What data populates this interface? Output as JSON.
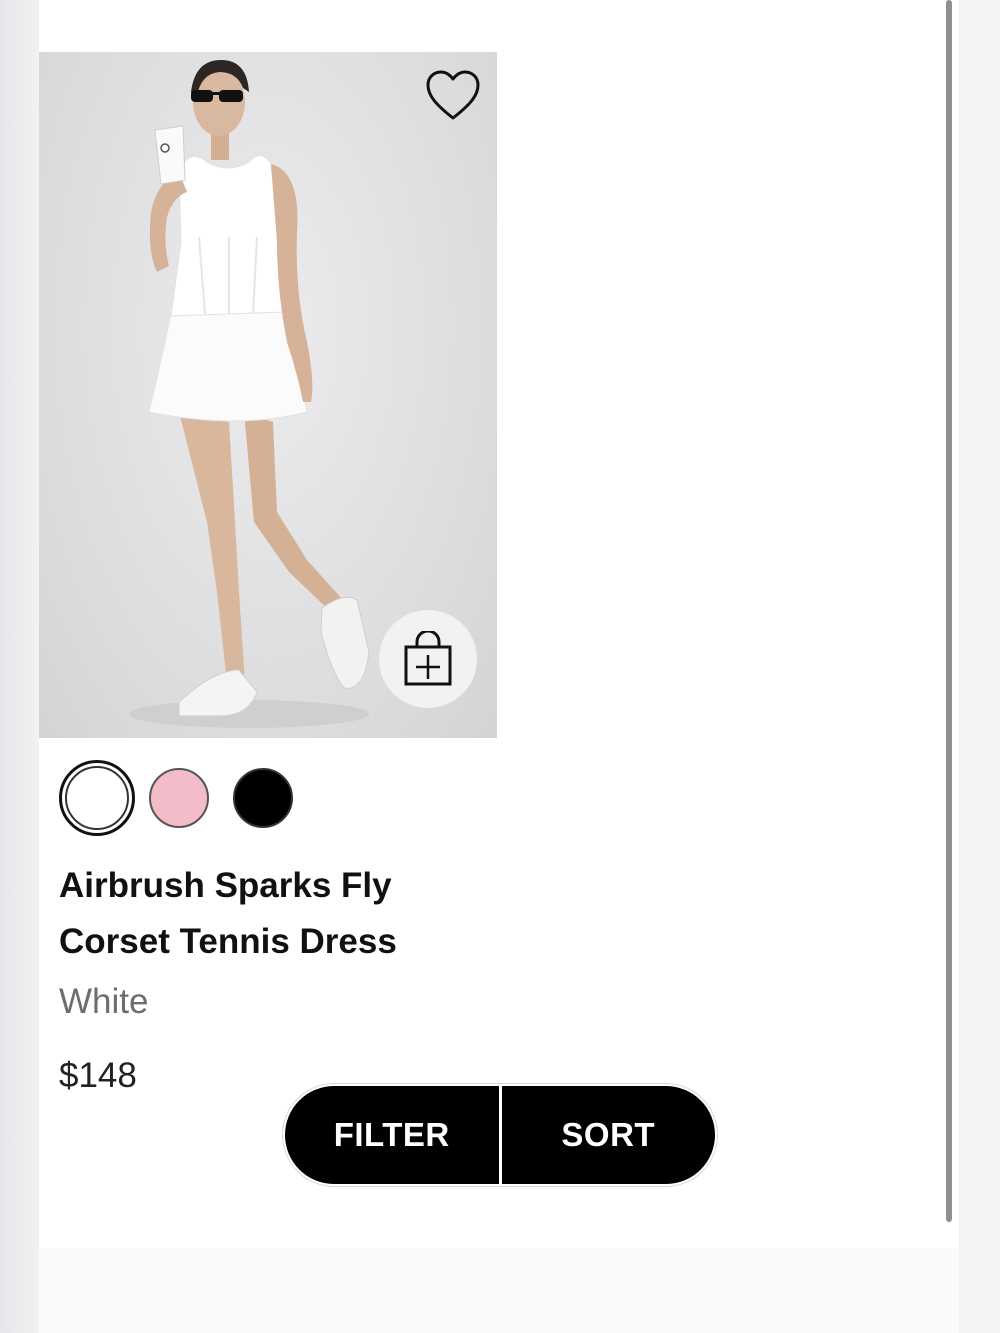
{
  "product": {
    "name_line1": "Airbrush Sparks Fly",
    "name_line2": "Corset Tennis Dress",
    "color": "White",
    "price": "$148"
  },
  "swatches": [
    {
      "name": "white",
      "hex": "#ffffff",
      "selected": true
    },
    {
      "name": "pink",
      "hex": "#f2bcc9",
      "selected": false
    },
    {
      "name": "black",
      "hex": "#000000",
      "selected": false
    }
  ],
  "controls": {
    "filter_label": "FILTER",
    "sort_label": "SORT"
  },
  "icons": {
    "wishlist": "heart-icon",
    "quick_add": "shopping-bag-plus-icon"
  }
}
